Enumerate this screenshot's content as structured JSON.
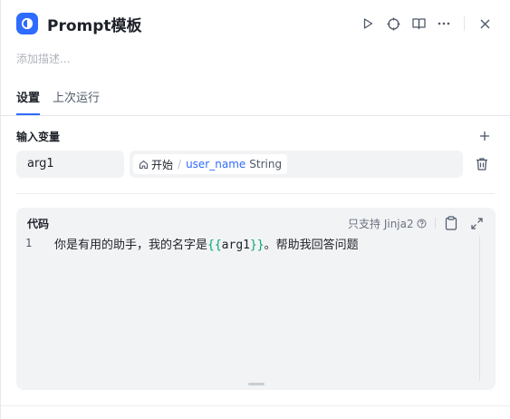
{
  "header": {
    "title": "Prompt模板",
    "accent": "#2f6bff",
    "actions": [
      "play-icon",
      "crosshair-icon",
      "book-icon",
      "more-icon",
      "close-icon"
    ]
  },
  "description_placeholder": "添加描述...",
  "tabs": [
    {
      "label": "设置",
      "active": true
    },
    {
      "label": "上次运行",
      "active": false
    }
  ],
  "input_vars": {
    "title": "输入变量",
    "items": [
      {
        "name": "arg1",
        "source": "开始",
        "separator": "/",
        "var": "user_name",
        "type": "String"
      }
    ]
  },
  "code": {
    "label": "代码",
    "jinja_note": "只支持 Jinja2",
    "line_number": "1",
    "text_before": "你是有用的助手，我的名字是",
    "brace_open": "{{",
    "var": "arg1",
    "brace_close": "}}",
    "text_after": "。帮助我回答问题"
  }
}
